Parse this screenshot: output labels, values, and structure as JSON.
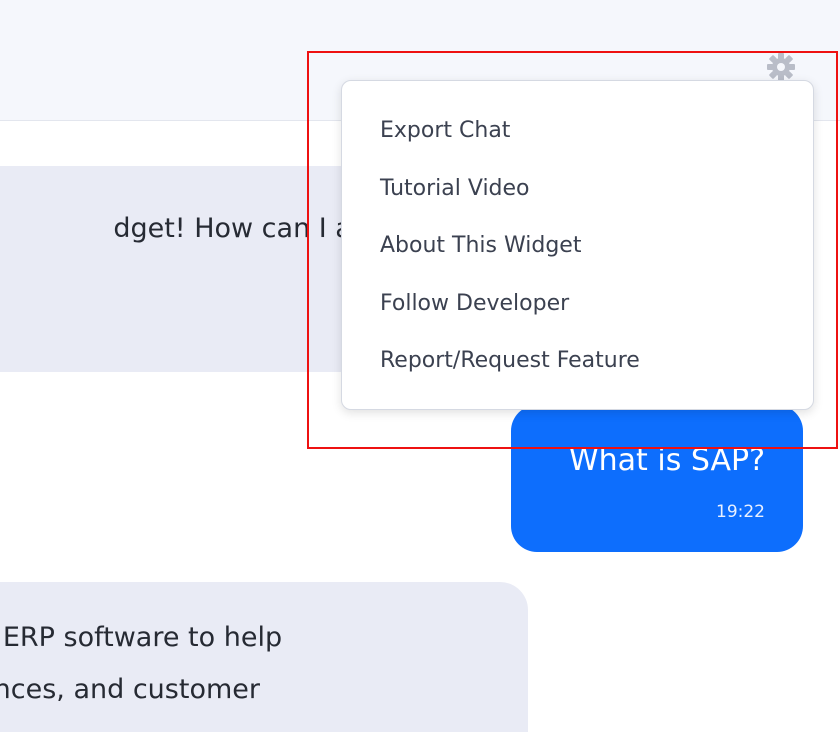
{
  "header": {
    "settings_icon": "gear-icon"
  },
  "messages": {
    "bot_greeting_visible": "dget! How can I ass",
    "user_question": "What is SAP?",
    "user_time": "19:22",
    "bot_answer_line1": "ng ERP software to help",
    "bot_answer_line2": "nances, and customer"
  },
  "settings_menu": {
    "items": [
      {
        "label": "Export Chat"
      },
      {
        "label": "Tutorial Video"
      },
      {
        "label": "About This Widget"
      },
      {
        "label": "Follow Developer"
      },
      {
        "label": "Report/Request Feature"
      }
    ]
  },
  "colors": {
    "user_bubble": "#0d6efd",
    "bot_bubble": "#e9ebf5",
    "highlight_border": "#ee1111"
  }
}
